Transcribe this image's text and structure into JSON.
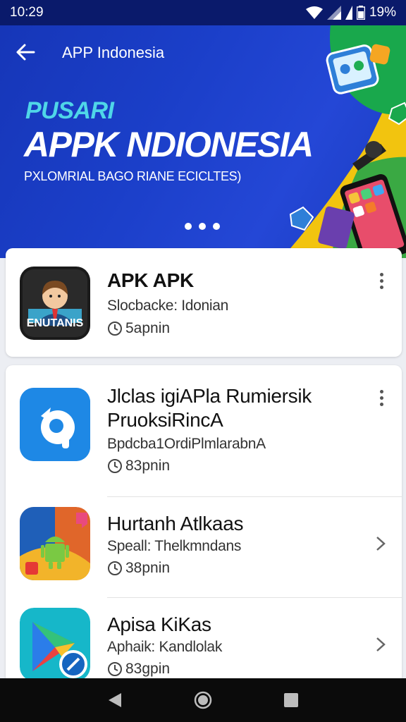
{
  "status_bar": {
    "time": "10:29",
    "battery": "19%"
  },
  "header": {
    "title": "APP Indonesia"
  },
  "banner": {
    "kicker": "PUSARI",
    "heading": "APPK NDIONESIA",
    "subheading": "PXLOMRIAL BAGO RIANE ECICLTES)",
    "slide_count": 3
  },
  "featured_app": {
    "name": "APK APK",
    "subtitle": "Slocbacke: Idonian",
    "size": "5apnin",
    "icon_text": "ENUTANIS"
  },
  "apps": [
    {
      "name_line1": "Jlclas igiAPla Rumiersik",
      "name_line2": "PruoksiRincA",
      "subtitle": "Bpdcba1OrdiPlmlarabnA",
      "size": "83pnin"
    },
    {
      "name_line1": "Hurtanh Atlkaas",
      "subtitle": "Speall: Thelkmndans",
      "size": "38pnin"
    },
    {
      "name_line1": "Apisa KiKas",
      "subtitle": "Aphaik: Kandlolak",
      "size": "83gpin"
    }
  ],
  "colors": {
    "banner_blue": "#1b3fc9",
    "accent_cyan": "#4fd6e8",
    "status_bar": "#0a1a6b"
  },
  "icons": [
    "back-arrow-icon",
    "wifi-icon",
    "signal-icon",
    "battery-icon",
    "more-vert-icon",
    "chevron-right-icon",
    "clock-icon",
    "nav-back-icon",
    "nav-home-icon",
    "nav-recents-icon"
  ]
}
